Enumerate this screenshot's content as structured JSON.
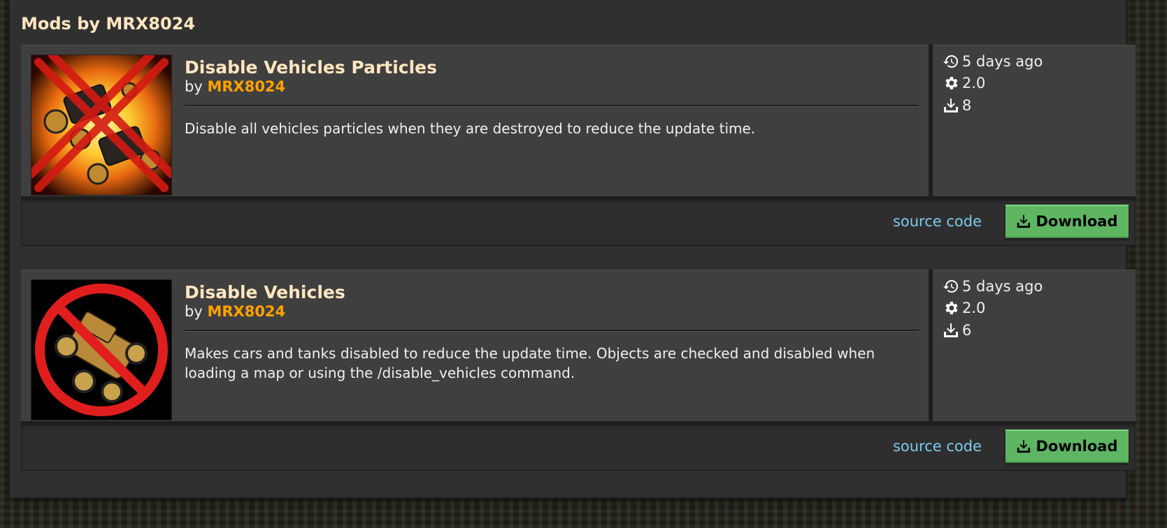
{
  "panel": {
    "title": "Mods by MRX8024"
  },
  "mods": [
    {
      "title": "Disable Vehicles Particles",
      "by_prefix": "by",
      "author": "MRX8024",
      "summary": "Disable all vehicles particles when they are destroyed to reduce the update time.",
      "updated": "5 days ago",
      "version": "2.0",
      "downloads": "8",
      "source_label": "source code",
      "download_label": "Download",
      "thumbnail_icon": "crossed-out-car-fire-icon"
    },
    {
      "title": "Disable Vehicles",
      "by_prefix": "by",
      "author": "MRX8024",
      "summary": "Makes cars and tanks disabled to reduce the update time. Objects are checked and disabled when loading a map or using the /disable_vehicles command.",
      "updated": "5 days ago",
      "version": "2.0",
      "downloads": "6",
      "source_label": "source code",
      "download_label": "Download",
      "thumbnail_icon": "no-car-sign-icon"
    }
  ],
  "colors": {
    "title": "#ffe6c0",
    "author": "#ffa200",
    "link": "#7dcaed",
    "download_button": "#5eb663"
  }
}
